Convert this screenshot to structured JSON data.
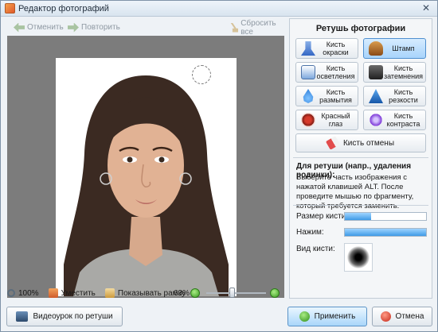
{
  "window": {
    "title": "Редактор фотографий",
    "close_label": "✕"
  },
  "toolbar": {
    "undo_label": "Отменить",
    "redo_label": "Повторить",
    "reset_label": "Сбросить все"
  },
  "status": {
    "zoom": "100%",
    "fit_label": "Уместить",
    "show_frame_label": "Показывать рамку",
    "zoom_percent": "63%",
    "zoom_slider_fraction": 0.43
  },
  "panel": {
    "title": "Ретушь фотографии",
    "tools": [
      {
        "label": "Кисть\nокраски",
        "icon": "paint-brush-icon",
        "active": false
      },
      {
        "label": "Штамп",
        "icon": "stamp-icon",
        "active": true
      },
      {
        "label": "Кисть\nосветления",
        "icon": "lighten-brush-icon",
        "active": false
      },
      {
        "label": "Кисть\nзатемнения",
        "icon": "darken-brush-icon",
        "active": false
      },
      {
        "label": "Кисть\nразмытия",
        "icon": "blur-brush-icon",
        "active": false
      },
      {
        "label": "Кисть\nрезкости",
        "icon": "sharpen-brush-icon",
        "active": false
      },
      {
        "label": "Красный\nглаз",
        "icon": "red-eye-icon",
        "active": false
      },
      {
        "label": "Кисть\nконтраста",
        "icon": "contrast-brush-icon",
        "active": false
      }
    ],
    "undo_brush_label": "Кисть отмены",
    "hint_title": "Для ретуши (напр., удаления родинки):",
    "hint_text": "Выберите часть изображения с нажатой клавишей ALT. После проведите мышью по фрагменту, который требуется заменить.",
    "brush_size_label": "Размер кисти:",
    "brush_size_fraction": 0.32,
    "pressure_label": "Нажим:",
    "pressure_fraction": 1.0,
    "brush_view_label": "Вид кисти:"
  },
  "buttons": {
    "video_label": "Видеоурок по ретуши",
    "apply_label": "Применить",
    "cancel_label": "Отмена"
  },
  "colors": {
    "accent": "#4f8fcf",
    "canvas_bg": "#7c7c7c"
  }
}
